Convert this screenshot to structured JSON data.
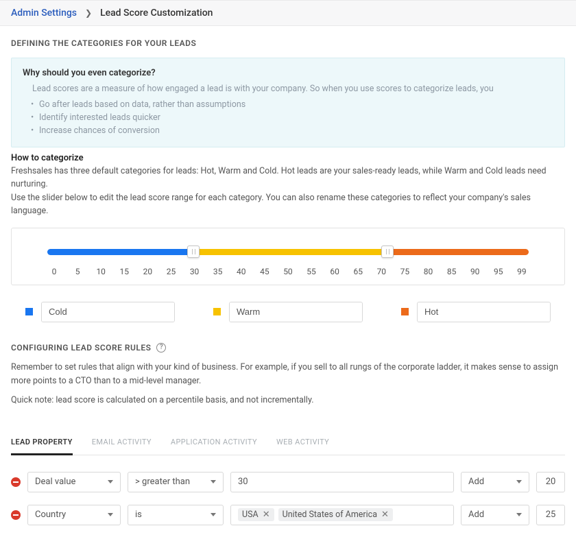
{
  "breadcrumb": {
    "root": "Admin Settings",
    "current": "Lead Score Customization"
  },
  "section1": {
    "title": "DEFINING THE CATEGORIES FOR YOUR LEADS",
    "info_question": "Why should you even categorize?",
    "info_lead": "Lead scores are a measure of how engaged a lead is with your company. So when you use scores to categorize leads, you",
    "bullets": [
      "Go after leads based on data, rather than assumptions",
      "Identify interested leads quicker",
      "Increase chances of conversion"
    ],
    "howto_title": "How to categorize",
    "howto_l1": "Freshsales has three default categories for leads: Hot, Warm and Cold. Hot leads are your sales-ready leads, while Warm and Cold leads need nurturing.",
    "howto_l2": "Use the slider below to edit the lead score range for each category. You can also rename these categories to reflect your company's sales language."
  },
  "ticks": [
    "0",
    "5",
    "10",
    "15",
    "20",
    "25",
    "30",
    "35",
    "40",
    "45",
    "50",
    "55",
    "60",
    "65",
    "70",
    "75",
    "80",
    "85",
    "90",
    "95",
    "99"
  ],
  "categories": [
    {
      "name": "Cold",
      "range": "0-30",
      "color": "sw-blue"
    },
    {
      "name": "Warm",
      "range": "31-70",
      "color": "sw-yellow"
    },
    {
      "name": "Hot",
      "range": "71-99",
      "color": "sw-orange"
    }
  ],
  "section2": {
    "title": "CONFIGURING LEAD SCORE RULES",
    "note1": "Remember to set rules that align with your kind of business. For example, if you sell to all rungs of the corporate ladder, it makes sense to assign more points to a CTO than to a mid-level manager.",
    "note2": "Quick note: lead score is calculated on a percentile basis, and not incrementally."
  },
  "tabs": [
    "LEAD  PROPERTY",
    "EMAIL  ACTIVITY",
    "APPLICATION  ACTIVITY",
    "WEB  ACTIVITY"
  ],
  "rules": [
    {
      "field": "Deal value",
      "op": "> greater than",
      "value_text": "30",
      "action": "Add",
      "points": "20",
      "chips": []
    },
    {
      "field": "Country",
      "op": "is",
      "value_text": "",
      "action": "Add",
      "points": "25",
      "chips": [
        "USA",
        "United States of America"
      ]
    }
  ]
}
